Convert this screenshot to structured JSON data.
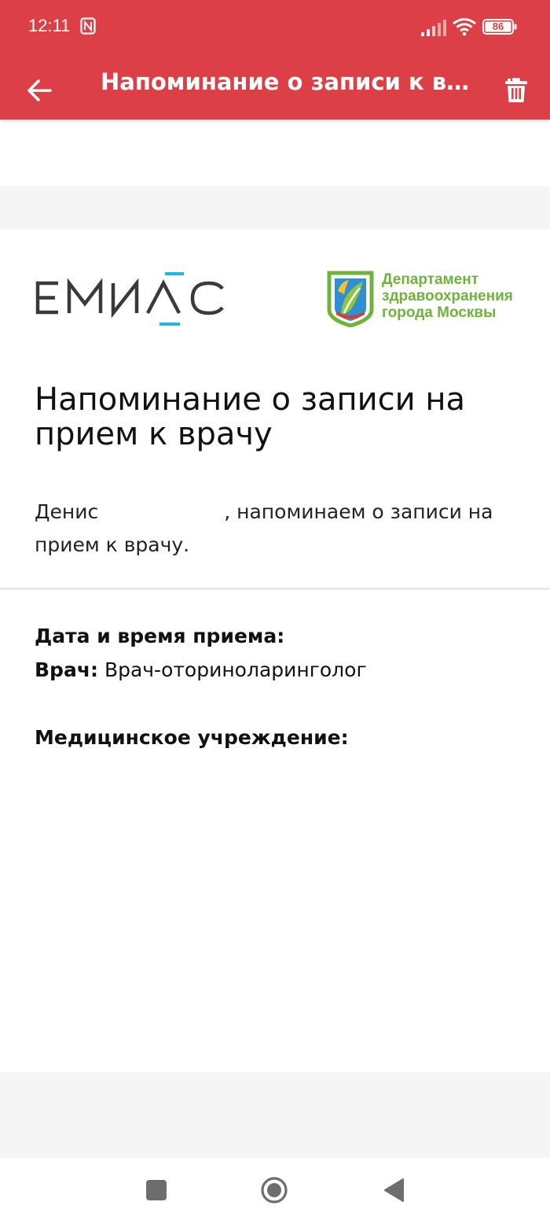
{
  "status_bar": {
    "time": "12:11",
    "battery": "86",
    "icons": [
      "nfc-icon",
      "signal-icon",
      "wifi-icon",
      "battery-icon"
    ]
  },
  "app_bar": {
    "title": "Напоминание о записи к врачу",
    "back_icon": "arrow-left-icon",
    "delete_icon": "trash-icon",
    "color": "#dc4046"
  },
  "logos": {
    "emias": "ЕМИАС",
    "department": [
      "Департамент",
      "здравоохранения",
      "города Москвы"
    ],
    "emias_accent": "#1fb5e6",
    "department_color": "#6fb33b"
  },
  "message": {
    "heading": "Напоминание о записи на прием к врачу",
    "greeting_name": "Денис",
    "greeting_rest": ", напоминаем о записи на прием к врачу."
  },
  "details": {
    "datetime_label": "Дата и время приема:",
    "doctor_label": "Врач:",
    "doctor_value": "Врач-оториноларинголог",
    "clinic_label": "Медицинское учреждение:"
  },
  "nav_bar": {
    "icons": [
      "recents-icon",
      "home-icon",
      "back-icon"
    ]
  }
}
